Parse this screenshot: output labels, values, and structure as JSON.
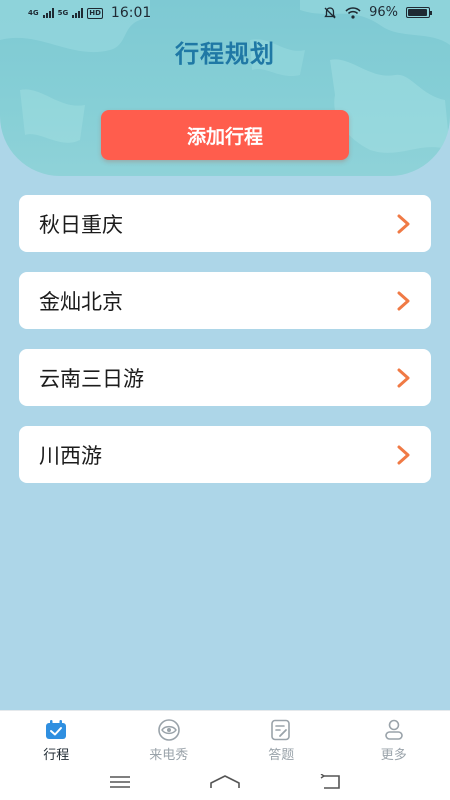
{
  "status_bar": {
    "network_left": "4G",
    "network_right": "5G",
    "hd": "HD",
    "time": "16:01",
    "battery": "96%",
    "battery_level": 0.96
  },
  "header": {
    "title": "行程规划",
    "add_button_label": "添加行程"
  },
  "trips": [
    {
      "label": "秋日重庆"
    },
    {
      "label": "金灿北京"
    },
    {
      "label": "云南三日游"
    },
    {
      "label": "川西游"
    }
  ],
  "tab_bar": {
    "items": [
      {
        "label": "行程",
        "icon": "calendar-icon",
        "active": true
      },
      {
        "label": "来电秀",
        "icon": "eye-icon",
        "active": false
      },
      {
        "label": "答题",
        "icon": "quiz-icon",
        "active": false
      },
      {
        "label": "更多",
        "icon": "user-icon",
        "active": false
      }
    ]
  },
  "colors": {
    "background": "#add6e8",
    "header": "#86cfd6",
    "title": "#1f78a5",
    "accent_button": "#ff5d4d",
    "chevron": "#f07a45",
    "tab_active": "#2f8fe0",
    "tab_inactive": "#9aa3aa"
  }
}
